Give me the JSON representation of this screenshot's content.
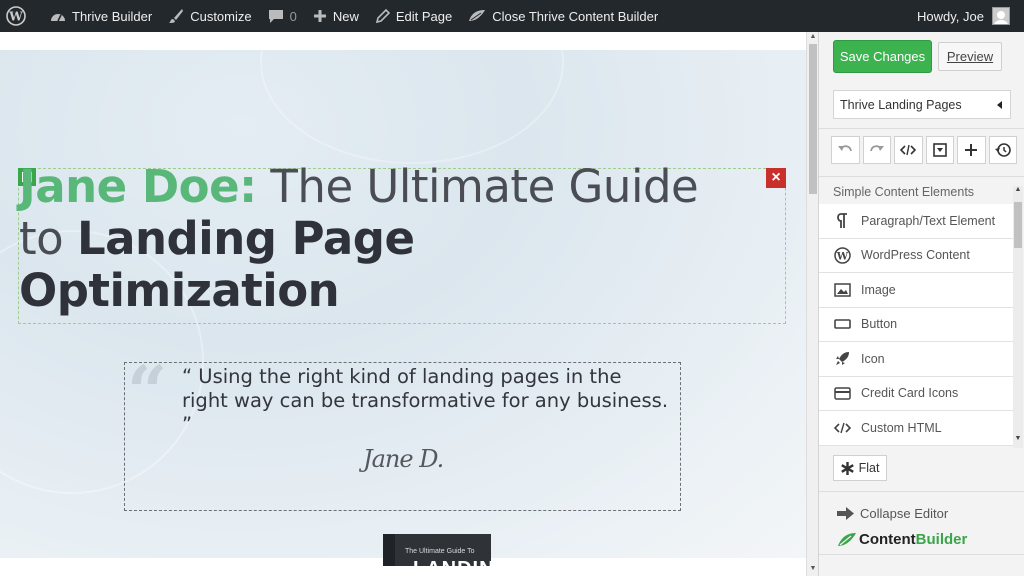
{
  "adminbar": {
    "site_name": "Thrive Builder",
    "customize": "Customize",
    "comments_count": "0",
    "new": "New",
    "edit_page": "Edit Page",
    "close_builder": "Close Thrive Content Builder",
    "greeting": "Howdy, Joe"
  },
  "headline": {
    "part1": "Jane Doe:",
    "part2": " The Ultimate Guide",
    "part3": "to ",
    "part4": "Landing Page",
    "part5": "Optimization"
  },
  "quote": {
    "text": "“ Using the right kind of landing pages in the right way can be transformative for any business. ”",
    "signature": "Jane D."
  },
  "book": {
    "subtitle": "The Ultimate Guide To",
    "title": "LANDING"
  },
  "sidebar": {
    "save_label": "Save Changes",
    "preview_label": "Preview",
    "template_selected": "Thrive Landing Pages",
    "elements_header": "Simple Content Elements",
    "elements": [
      {
        "label": "Paragraph/Text Element",
        "icon": "paragraph-icon"
      },
      {
        "label": "WordPress Content",
        "icon": "wordpress-icon"
      },
      {
        "label": "Image",
        "icon": "image-icon"
      },
      {
        "label": "Button",
        "icon": "button-icon"
      },
      {
        "label": "Icon",
        "icon": "rocket-icon"
      },
      {
        "label": "Credit Card Icons",
        "icon": "credit-card-icon"
      },
      {
        "label": "Custom HTML",
        "icon": "code-icon"
      }
    ],
    "flat_label": "Flat",
    "collapse_label": "Collapse Editor",
    "brand_part1": "Content",
    "brand_part2": "Builder"
  },
  "colors": {
    "adminbar_bg": "#23282d",
    "accent_green": "#3cb34f",
    "headline_green": "#59b77a",
    "close_red": "#c9302c"
  }
}
